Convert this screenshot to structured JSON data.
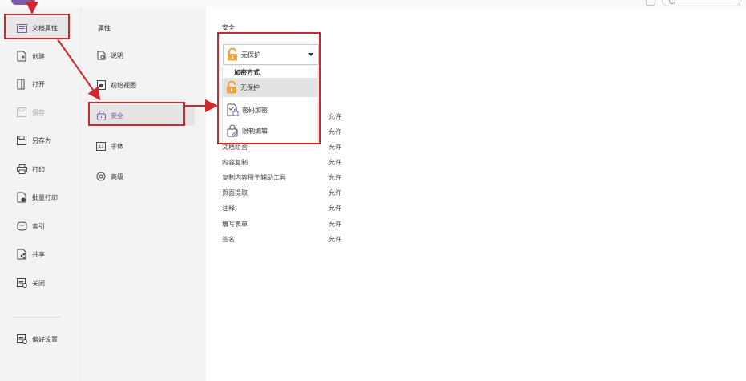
{
  "left_nav": {
    "items": [
      {
        "label": "文档属性",
        "icon": "document-properties-icon",
        "selected": true
      },
      {
        "label": "创建",
        "icon": "create-icon"
      },
      {
        "label": "打开",
        "icon": "open-icon"
      },
      {
        "label": "保存",
        "icon": "save-icon",
        "disabled": true
      },
      {
        "label": "另存为",
        "icon": "save-as-icon"
      },
      {
        "label": "打印",
        "icon": "print-icon"
      },
      {
        "label": "批量打印",
        "icon": "batch-print-icon"
      },
      {
        "label": "索引",
        "icon": "index-icon"
      },
      {
        "label": "共享",
        "icon": "share-icon"
      },
      {
        "label": "关闭",
        "icon": "close-icon"
      },
      {
        "label": "偏好设置",
        "icon": "preferences-icon"
      }
    ]
  },
  "properties_panel": {
    "title": "属性",
    "items": [
      {
        "label": "说明",
        "icon": "description-icon"
      },
      {
        "label": "初始视图",
        "icon": "initial-view-icon"
      },
      {
        "label": "安全",
        "icon": "security-icon",
        "selected": true
      },
      {
        "label": "字体",
        "icon": "font-icon"
      },
      {
        "label": "高级",
        "icon": "advanced-icon"
      }
    ]
  },
  "security": {
    "section_title": "安全",
    "dropdown_value": "无保护",
    "dropdown_header": "加密方式",
    "options": [
      {
        "label": "无保护",
        "icon": "unlock-icon"
      },
      {
        "label": "密码加密",
        "icon": "password-encrypt-icon"
      },
      {
        "label": "限制编辑",
        "icon": "restrict-edit-icon"
      }
    ],
    "permissions": [
      {
        "name": "",
        "value": "允许"
      },
      {
        "name": "",
        "value": "允许"
      },
      {
        "name": "文档组合",
        "value": "允许"
      },
      {
        "name": "内容复制",
        "value": "允许"
      },
      {
        "name": "复制内容用于辅助工具",
        "value": "允许"
      },
      {
        "name": "页面提取",
        "value": "允许"
      },
      {
        "name": "注释",
        "value": "允许"
      },
      {
        "name": "填写表单",
        "value": "允许"
      },
      {
        "name": "签名",
        "value": "允许"
      }
    ]
  },
  "colors": {
    "accent": "#7b5ea7",
    "annotation": "#d0262c",
    "lock": "#f0a33a"
  }
}
